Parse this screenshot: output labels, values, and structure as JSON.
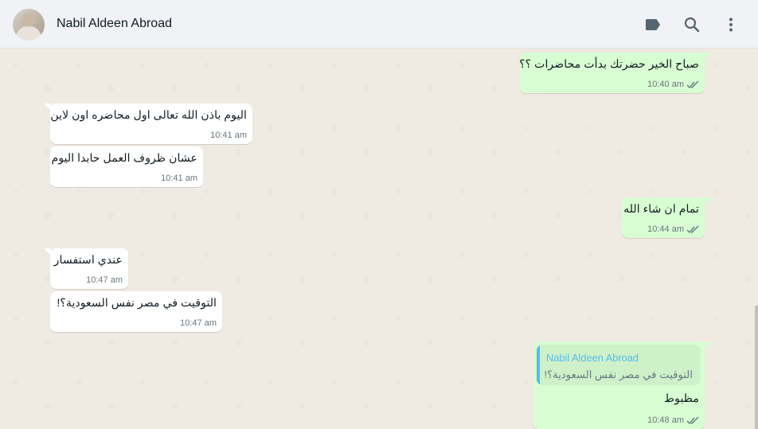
{
  "header": {
    "contact_name": "Nabil Aldeen Abroad",
    "icons": [
      "label-icon",
      "search-icon",
      "menu-icon"
    ]
  },
  "colors": {
    "incoming_bubble": "#ffffff",
    "outgoing_bubble": "#d9fdd3",
    "quote_accent": "#53bdeb",
    "chat_background": "#efeae2"
  },
  "messages": [
    {
      "direction": "out",
      "text": "صباح الخير حضرتك بدأت محاضرات ؟؟",
      "time": "10:40 am",
      "status": "read"
    },
    {
      "direction": "in",
      "text": "اليوم باذن الله تعالى اول محاضره اون لاين",
      "time": "10:41 am"
    },
    {
      "direction": "in",
      "text": "عشان ظروف العمل حابدا اليوم",
      "time": "10:41 am"
    },
    {
      "direction": "out",
      "text": "تمام ان شاء الله",
      "time": "10:44 am",
      "status": "read"
    },
    {
      "direction": "in",
      "text": "عندي استفسار",
      "time": "10:47 am"
    },
    {
      "direction": "in",
      "text": "التوقيت في مصر نفس السعودية؟!",
      "time": "10:47 am"
    },
    {
      "direction": "out",
      "text": "مظبوط",
      "time": "10:48 am",
      "status": "read",
      "quote": {
        "author": "Nabil Aldeen Abroad",
        "text": "التوقيت في مصر نفس السعودية؟!"
      }
    }
  ]
}
